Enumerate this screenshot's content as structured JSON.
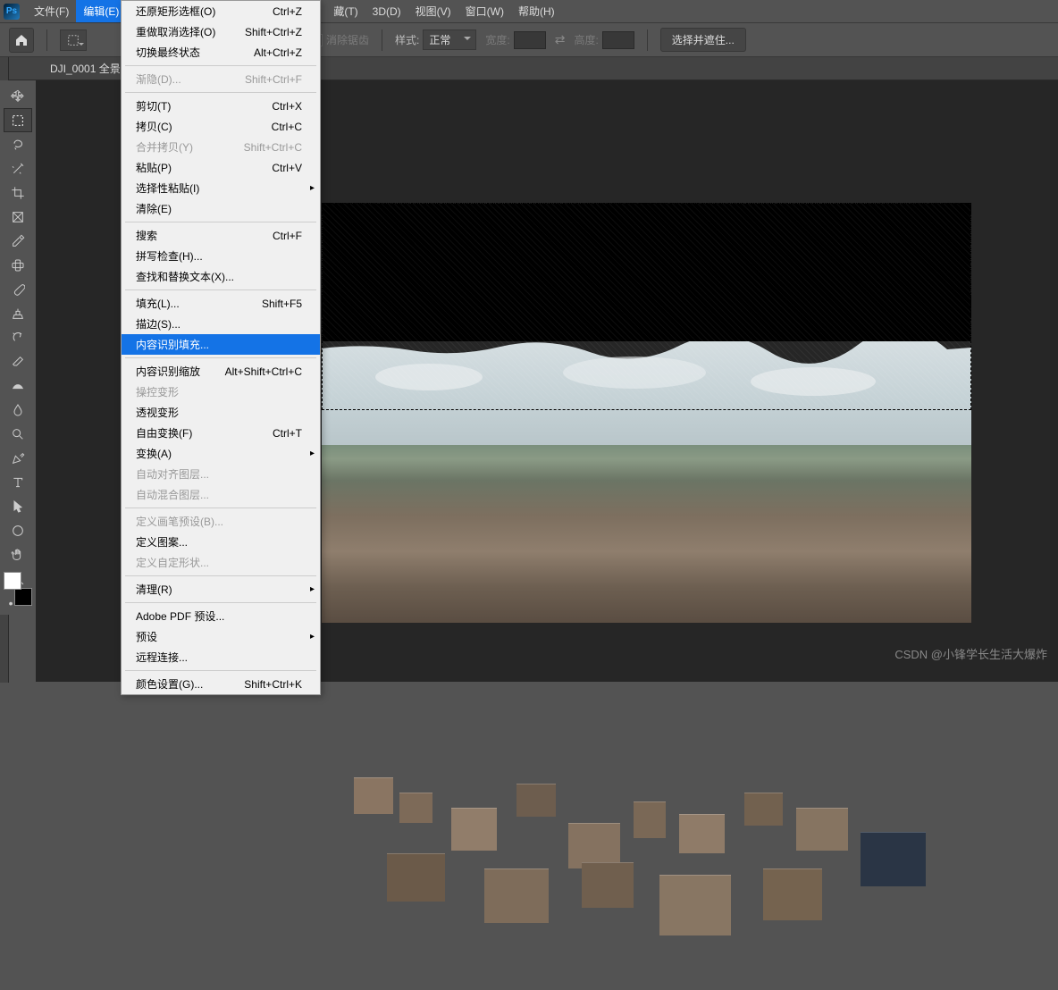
{
  "menubar": {
    "file": "文件(F)",
    "edit": "编辑(E)",
    "hidden_t": "藏(T)",
    "3d": "3D(D)",
    "view": "视图(V)",
    "window": "窗口(W)",
    "help": "帮助(H)"
  },
  "options": {
    "antialias": "消除锯齿",
    "style_label": "样式:",
    "style_value": "正常",
    "width_label": "宽度:",
    "height_label": "高度:",
    "select_mask": "选择并遮住..."
  },
  "tab": {
    "name": "DJI_0001 全景"
  },
  "edit_menu": {
    "undo": {
      "label": "还原矩形选框(O)",
      "shortcut": "Ctrl+Z"
    },
    "redo": {
      "label": "重做取消选择(O)",
      "shortcut": "Shift+Ctrl+Z"
    },
    "toggle": {
      "label": "切换最终状态",
      "shortcut": "Alt+Ctrl+Z"
    },
    "fade": {
      "label": "渐隐(D)...",
      "shortcut": "Shift+Ctrl+F"
    },
    "cut": {
      "label": "剪切(T)",
      "shortcut": "Ctrl+X"
    },
    "copy": {
      "label": "拷贝(C)",
      "shortcut": "Ctrl+C"
    },
    "copy_merged": {
      "label": "合并拷贝(Y)",
      "shortcut": "Shift+Ctrl+C"
    },
    "paste": {
      "label": "粘贴(P)",
      "shortcut": "Ctrl+V"
    },
    "paste_special": {
      "label": "选择性粘贴(I)"
    },
    "clear": {
      "label": "清除(E)"
    },
    "search": {
      "label": "搜索",
      "shortcut": "Ctrl+F"
    },
    "spell": {
      "label": "拼写检查(H)..."
    },
    "find_replace": {
      "label": "查找和替换文本(X)..."
    },
    "fill": {
      "label": "填充(L)...",
      "shortcut": "Shift+F5"
    },
    "stroke": {
      "label": "描边(S)..."
    },
    "content_aware_fill": {
      "label": "内容识别填充..."
    },
    "content_aware_scale": {
      "label": "内容识别缩放",
      "shortcut": "Alt+Shift+Ctrl+C"
    },
    "puppet": {
      "label": "操控变形"
    },
    "perspective": {
      "label": "透视变形"
    },
    "free_transform": {
      "label": "自由变换(F)",
      "shortcut": "Ctrl+T"
    },
    "transform": {
      "label": "变换(A)"
    },
    "auto_align": {
      "label": "自动对齐图层..."
    },
    "auto_blend": {
      "label": "自动混合图层..."
    },
    "define_brush": {
      "label": "定义画笔预设(B)..."
    },
    "define_pattern": {
      "label": "定义图案..."
    },
    "define_shape": {
      "label": "定义自定形状..."
    },
    "purge": {
      "label": "清理(R)"
    },
    "adobe_pdf": {
      "label": "Adobe PDF 预设..."
    },
    "presets": {
      "label": "预设"
    },
    "remote": {
      "label": "远程连接..."
    },
    "color_settings": {
      "label": "颜色设置(G)...",
      "shortcut": "Shift+Ctrl+K"
    }
  },
  "watermark": "CSDN @小锋学长生活大爆炸"
}
